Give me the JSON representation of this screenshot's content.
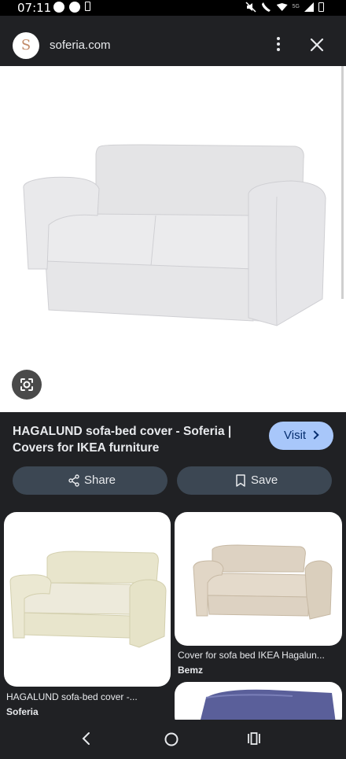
{
  "status_bar": {
    "time": "07:11",
    "network": "5G"
  },
  "url_bar": {
    "site_logo_letter": "S",
    "domain": "soferia.com"
  },
  "result": {
    "title": "HAGALUND sofa-bed cover - Soferia | Covers for IKEA furniture",
    "visit_label": "Visit",
    "share_label": "Share",
    "save_label": "Save"
  },
  "related": [
    {
      "title": "HAGALUND sofa-bed cover -...",
      "source": "Soferia",
      "sofa_color": "#e8e5cc"
    },
    {
      "title": "Cover for sofa bed IKEA Hagalun...",
      "source": "Bemz",
      "sofa_color": "#ddd2c2"
    },
    {
      "title": "",
      "source": "",
      "sofa_color": "#5a5f9a"
    }
  ],
  "colors": {
    "visit_bg": "#a8c7fa",
    "button_bg": "#3c4753",
    "page_bg": "#202124"
  }
}
